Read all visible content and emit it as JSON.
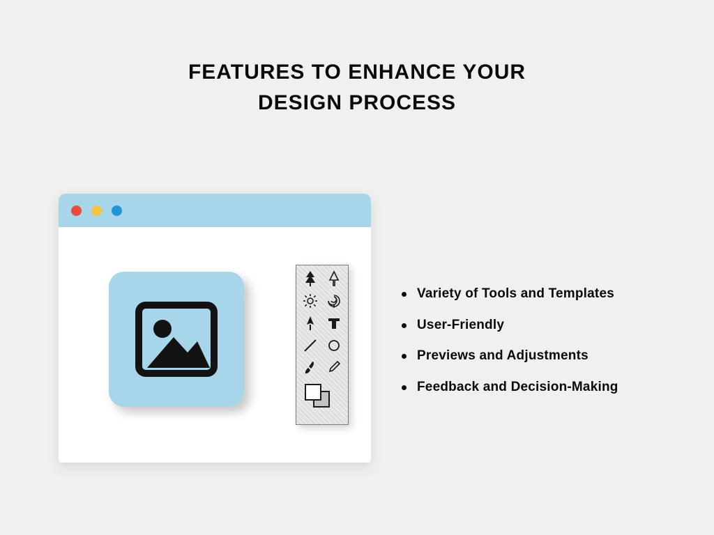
{
  "title_line1": "FEATURES TO ENHANCE YOUR",
  "title_line2": "DESIGN PROCESS",
  "features": {
    "items": [
      "Variety of Tools and Templates",
      "User-Friendly",
      "Previews and Adjustments",
      "Feedback and Decision-Making"
    ]
  },
  "illustration": {
    "window_dots": [
      "red",
      "yellow",
      "blue"
    ],
    "image_tile": "image-placeholder",
    "palette_tools": [
      "tree-icon",
      "arrow-icon",
      "sun-icon",
      "spiral-icon",
      "pen-icon",
      "text-icon",
      "line-icon",
      "circle-icon",
      "brush-icon",
      "pencil-icon"
    ],
    "swatch_front": "#ffffff",
    "swatch_back": "#c2c2c2"
  },
  "colors": {
    "background": "#f0f0f0",
    "accent": "#a7d6ea",
    "text": "#0a0a0a"
  }
}
